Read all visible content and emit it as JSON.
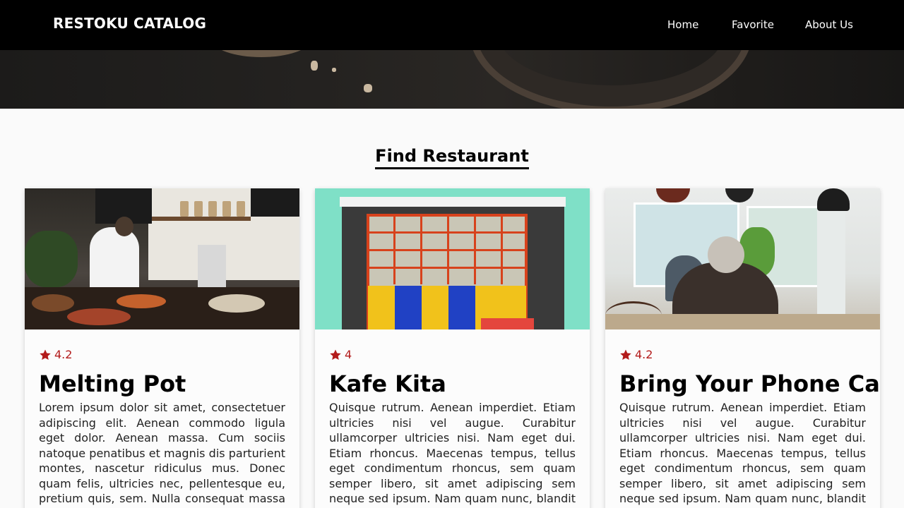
{
  "header": {
    "brand": "RESTOKU CATALOG",
    "nav": [
      "Home",
      "Favorite",
      "About Us"
    ]
  },
  "main": {
    "title": "Find Restaurant"
  },
  "restaurants": [
    {
      "rating": "4.2",
      "name": "Melting Pot",
      "description": "Lorem ipsum dolor sit amet, consectetuer adipiscing elit. Aenean commodo ligula eget dolor. Aenean massa. Cum sociis natoque penatibus et magnis dis parturient montes, nascetur ridiculus mus. Donec quam felis, ultricies nec, pellentesque eu, pretium quis, sem. Nulla consequat massa quis enim. Donec"
    },
    {
      "rating": "4",
      "name": "Kafe Kita",
      "description": "Quisque rutrum. Aenean imperdiet. Etiam ultricies nisi vel augue. Curabitur ullamcorper ultricies nisi. Nam eget dui. Etiam rhoncus. Maecenas tempus, tellus eget condimentum rhoncus, sem quam semper libero, sit amet adipiscing sem neque sed ipsum. Nam quam nunc, blandit vel, luctus pulvinar, hendrerer"
    },
    {
      "rating": "4.2",
      "name": "Bring Your Phone Cafe",
      "description": "Quisque rutrum. Aenean imperdiet. Etiam ultricies nisi vel augue. Curabitur ullamcorper ultricies nisi. Nam eget dui. Etiam rhoncus. Maecenas tempus, tellus eget condimentum rhoncus, sem quam semper libero, sit amet adipiscing sem neque sed ipsum. Nam quam nunc, blandit vel, luctus pulvinar, hendrerer"
    }
  ],
  "colors": {
    "navbar_bg": "#000000",
    "rating": "#b31b1b",
    "page_bg": "#fafafa"
  },
  "icons": {
    "rating": "star-icon"
  }
}
